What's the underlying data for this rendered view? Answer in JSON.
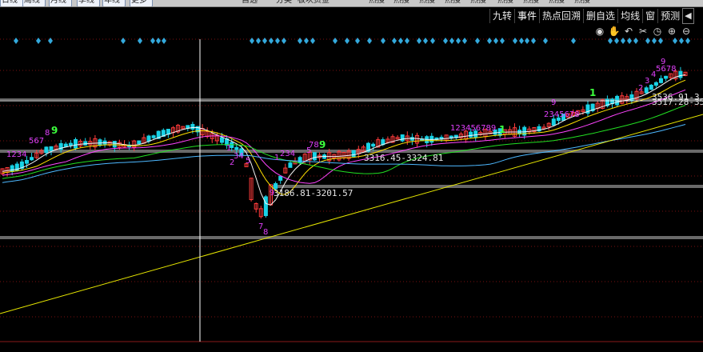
{
  "top_tabs": [
    "日线",
    "周线",
    "月线",
    "季线",
    "年线",
    "更多",
    "自选",
    "分类",
    "板块资金",
    "热搜",
    "热搜",
    "热搜",
    "热搜",
    "热搜",
    "热搜",
    "热搜",
    "热搜",
    "热搜"
  ],
  "toolbar": {
    "items": [
      "九转",
      "事件",
      "热点回溯",
      "删自选",
      "均线",
      "窗",
      "预测"
    ],
    "back_icon": "left-triangle-icon"
  },
  "icon_row": [
    {
      "name": "eye-icon",
      "glyph": "◉"
    },
    {
      "name": "hand-icon",
      "glyph": "✋"
    },
    {
      "name": "undo-icon",
      "glyph": "↶"
    },
    {
      "name": "scissors-icon",
      "glyph": "✂"
    },
    {
      "name": "clock-icon",
      "glyph": "◷"
    },
    {
      "name": "zoom-in-icon",
      "glyph": "⊕"
    },
    {
      "name": "zoom-out-icon",
      "glyph": "⊖"
    }
  ],
  "colors": {
    "background": "#000000",
    "up": "#ff3b3b",
    "down": "#19d3e6",
    "seq_count": "#e040fb",
    "seq_nine": "#3dff3d",
    "trendline": "#e6e600",
    "ma_white": "#f5f5f5",
    "ma_yellow": "#ffe100",
    "ma_magenta": "#ff44ff",
    "ma_green": "#22e022",
    "ma_cyan": "#4db8ff",
    "label": "#e6e6e6",
    "sr_band": "#8c8c8c",
    "marker": "#33aadd"
  },
  "chart_data": {
    "type": "candlestick",
    "title": "",
    "price_labels": [
      {
        "text": "3186.81-3201.57"
      },
      {
        "text": "3316.45-3324.81"
      },
      {
        "text": "3536.91-3"
      },
      {
        "text": "3517.28-35"
      }
    ],
    "sequential_labels": [
      {
        "text": "1234"
      },
      {
        "text": "567"
      },
      {
        "text": "8"
      },
      {
        "text": "9"
      },
      {
        "text": "1"
      },
      {
        "text": "2"
      },
      {
        "text": "34"
      },
      {
        "text": "5"
      },
      {
        "text": "7"
      },
      {
        "text": "8"
      },
      {
        "text": "9"
      },
      {
        "text": "1"
      },
      {
        "text": "234"
      },
      {
        "text": "5"
      },
      {
        "text": "78"
      },
      {
        "text": "9"
      },
      {
        "text": "123456789"
      },
      {
        "text": "1"
      },
      {
        "text": "2345678"
      },
      {
        "text": "9"
      },
      {
        "text": "1"
      },
      {
        "text": "2"
      },
      {
        "text": "3"
      },
      {
        "text": "4"
      },
      {
        "text": "5678"
      },
      {
        "text": "9"
      }
    ],
    "crosshair": true
  }
}
